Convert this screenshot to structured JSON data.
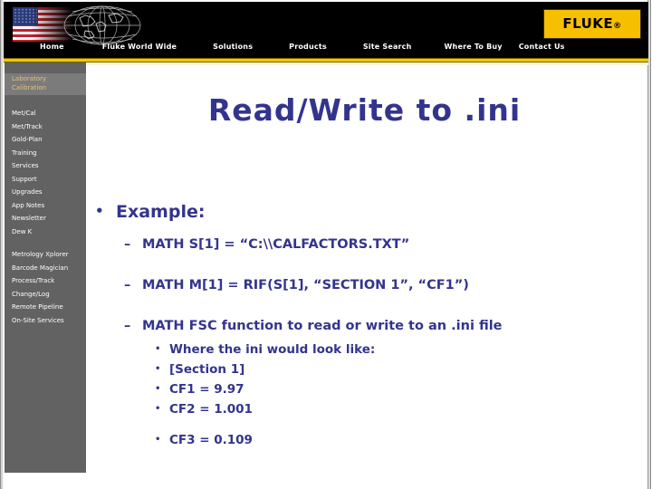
{
  "header": {
    "brand_logo_text": "FLUKE",
    "brand_logo_mark": "®",
    "flag_icon": "us-flag-icon",
    "globe_icon": "wireframe-globe-icon",
    "nav": [
      {
        "label": "Home"
      },
      {
        "label": "Fluke World Wide"
      },
      {
        "label": "Solutions"
      },
      {
        "label": "Products"
      },
      {
        "label": "Site Search"
      },
      {
        "label": "Where To Buy"
      },
      {
        "label": "Contact Us"
      }
    ]
  },
  "sidebar": {
    "section_title_line1": "Laboratory",
    "section_title_line2": "Calibration",
    "group_one": [
      {
        "label": "Met/Cal"
      },
      {
        "label": "Met/Track"
      },
      {
        "label": "Gold-Plan"
      },
      {
        "label": "Training"
      },
      {
        "label": "Services"
      },
      {
        "label": "Support"
      },
      {
        "label": "Upgrades"
      },
      {
        "label": "App Notes"
      },
      {
        "label": "Newsletter"
      },
      {
        "label": "Dew K"
      }
    ],
    "group_two": [
      {
        "label": "Metrology Xplorer"
      },
      {
        "label": "Barcode Magician"
      },
      {
        "label": "Process/Track"
      },
      {
        "label": "Change/Log"
      },
      {
        "label": "Remote Pipeline"
      },
      {
        "label": "On-Site Services"
      }
    ]
  },
  "slide": {
    "title": "Read/Write to .ini",
    "bullet_example": "Example:",
    "line_math_s": "MATH S[1] = “C:\\\\CALFACTORS.TXT”",
    "line_math_m": "MATH M[1] = RIF(S[1], “SECTION 1”, “CF1”)",
    "line_math_fsc": "MATH FSC function to read or write to an .ini file",
    "sub_where": "Where the ini would look like:",
    "sub_section": "[Section 1]",
    "sub_cf1": "CF1 = 9.97",
    "sub_cf2": "CF2 = 1.001",
    "sub_cf3": "CF3 = 0.109"
  },
  "colors": {
    "slide_text": "#33348e",
    "brand_yellow": "#f6bf00",
    "gold_rule": "#f2c800",
    "sidebar_gray": "#626262",
    "sidebar_highlight": "#7b7b7b",
    "sidebar_title_gold": "#e5c37a",
    "header_black": "#000000"
  }
}
